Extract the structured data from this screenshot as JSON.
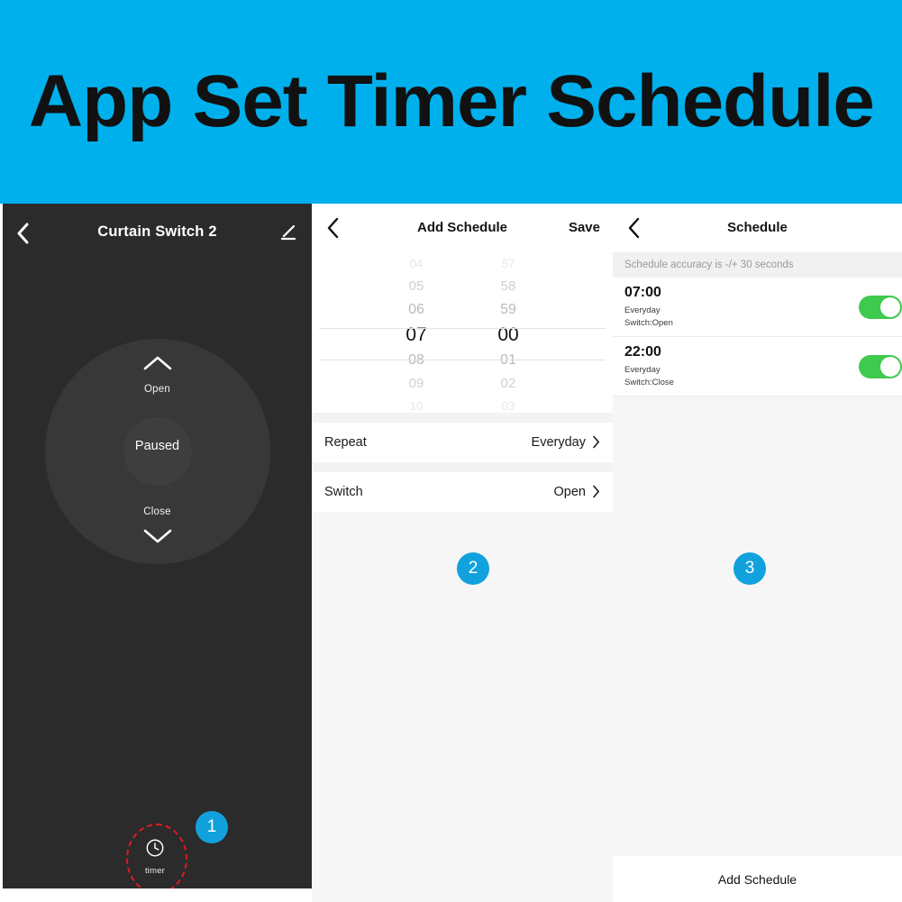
{
  "banner": {
    "title": "App Set Timer Schedule",
    "bg_color": "#00b0ec",
    "text_color": "#111111"
  },
  "badges": {
    "one": "1",
    "two": "2",
    "three": "3",
    "color": "#11a2dd"
  },
  "left_panel": {
    "back_icon": "chevron-left-icon",
    "title": "Curtain Switch 2",
    "edit_icon": "pencil-edit-icon",
    "dial": {
      "open_label": "Open",
      "open_icon": "chevron-up-icon",
      "state": "Paused",
      "close_label": "Close",
      "close_icon": "chevron-down-icon"
    },
    "timer": {
      "icon": "clock-icon",
      "label": "timer",
      "highlight_color": "#e01b22"
    }
  },
  "mid_panel": {
    "back_icon": "chevron-left-icon",
    "title": "Add Schedule",
    "save_label": "Save",
    "picker": {
      "hours": [
        "04",
        "05",
        "06",
        "07",
        "08",
        "09",
        "10"
      ],
      "minutes": [
        "57",
        "58",
        "59",
        "00",
        "01",
        "02",
        "03"
      ],
      "selected_hour": "07",
      "selected_minute": "00",
      "selected_index": 3
    },
    "rows": [
      {
        "label": "Repeat",
        "value": "Everyday",
        "chevron": "chevron-right-icon"
      },
      {
        "label": "Switch",
        "value": "Open",
        "chevron": "chevron-right-icon"
      }
    ]
  },
  "right_panel": {
    "back_icon": "chevron-left-icon",
    "title": "Schedule",
    "notice": "Schedule accuracy is -/+ 30 seconds",
    "items": [
      {
        "time": "07:00",
        "repeat": "Everyday",
        "action": "Switch:Open",
        "enabled": true
      },
      {
        "time": "22:00",
        "repeat": "Everyday",
        "action": "Switch:Close",
        "enabled": true
      }
    ],
    "toggle_on_color": "#3ec94f",
    "add_schedule_label": "Add Schedule"
  }
}
